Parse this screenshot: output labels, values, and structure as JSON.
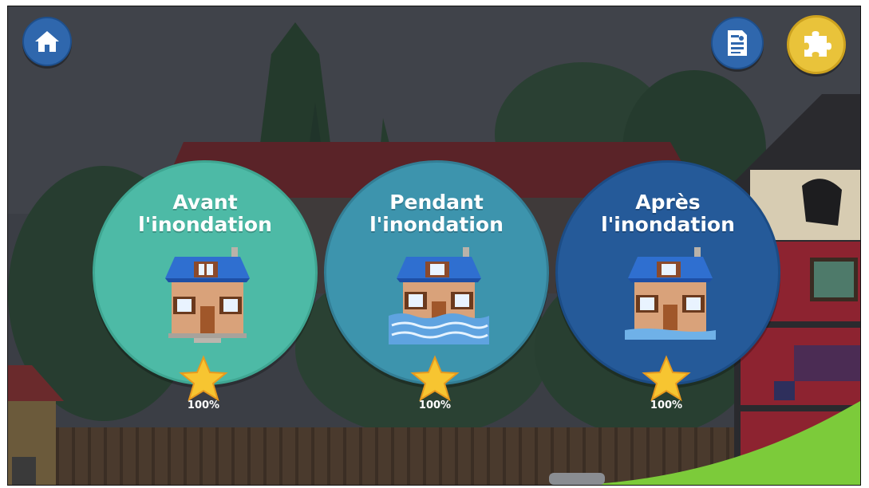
{
  "header": {
    "home_icon": "home-icon",
    "document_icon": "document-icon",
    "puzzle_icon": "puzzle-icon"
  },
  "levels": [
    {
      "title_line1": "Avant",
      "title_line2": "l'inondation",
      "progress": "100%",
      "progress_value": 1.0,
      "color": "#4dbaa6",
      "house_state": "dry"
    },
    {
      "title_line1": "Pendant",
      "title_line2": "l'inondation",
      "progress": "100%",
      "progress_value": 1.0,
      "color": "#3d94ad",
      "house_state": "flooded"
    },
    {
      "title_line1": "Après",
      "title_line2": "l'inondation",
      "progress": "100%",
      "progress_value": 1.0,
      "color": "#255a99",
      "house_state": "receding"
    }
  ],
  "colors": {
    "star": "#f7c531",
    "button_blue": "#2f67ad",
    "puzzle_gold": "#e9c33a"
  }
}
